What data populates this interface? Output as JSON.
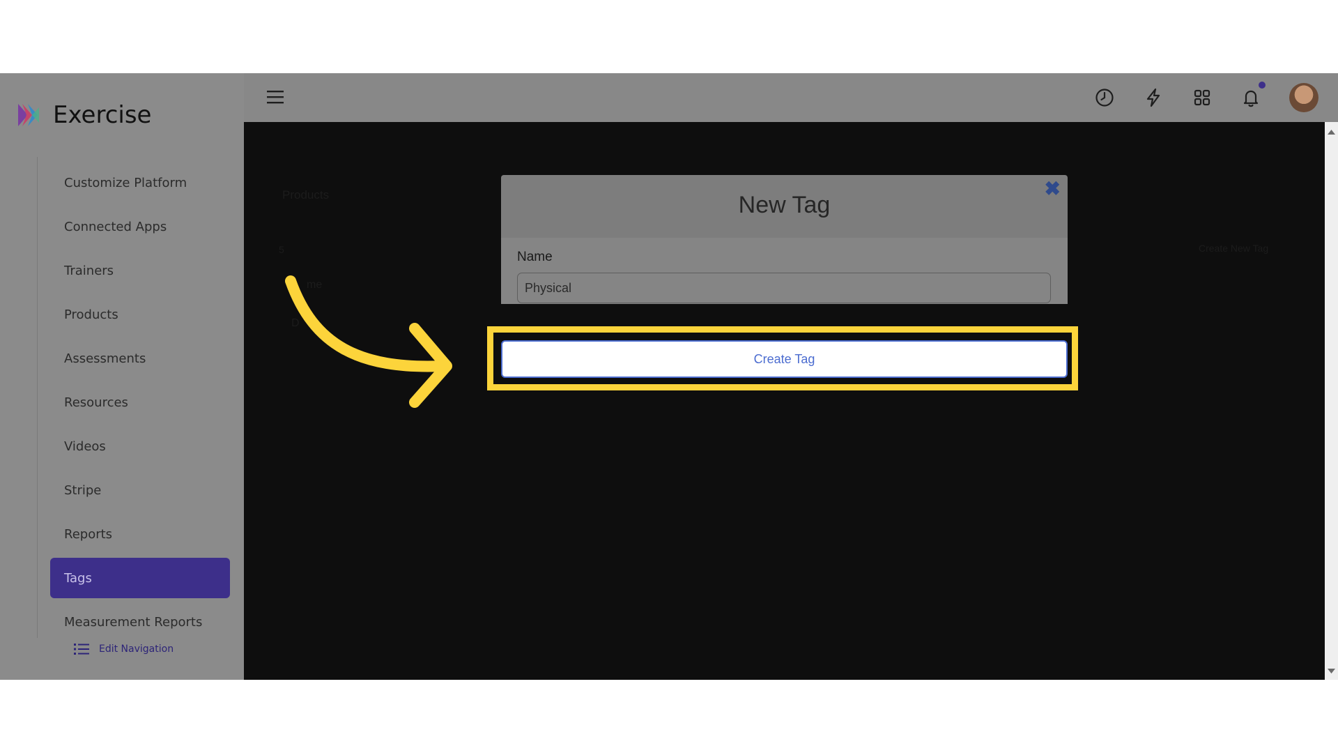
{
  "app": {
    "name": "Exercise"
  },
  "sidebar": {
    "items": [
      {
        "label": "Customize Platform"
      },
      {
        "label": "Connected Apps"
      },
      {
        "label": "Trainers"
      },
      {
        "label": "Products"
      },
      {
        "label": "Assessments"
      },
      {
        "label": "Resources"
      },
      {
        "label": "Videos"
      },
      {
        "label": "Stripe"
      },
      {
        "label": "Reports"
      },
      {
        "label": "Tags",
        "active": true
      },
      {
        "label": "Measurement Reports"
      }
    ],
    "edit_navigation": "Edit Navigation"
  },
  "topbar": {
    "icons": [
      "menu-icon",
      "history-icon",
      "lightning-icon",
      "apps-grid-icon",
      "bell-icon",
      "avatar"
    ]
  },
  "background_page": {
    "title": "Products",
    "page_size": "5",
    "column_header": "me",
    "row_text": "D",
    "right_action": "Create New Tag"
  },
  "modal": {
    "title": "New Tag",
    "name_label": "Name",
    "name_value": "Physical",
    "submit_label": "Create Tag"
  },
  "colors": {
    "accent": "#3d2f8a",
    "highlight": "#fcd43b",
    "button_text": "#4b6cd0"
  }
}
